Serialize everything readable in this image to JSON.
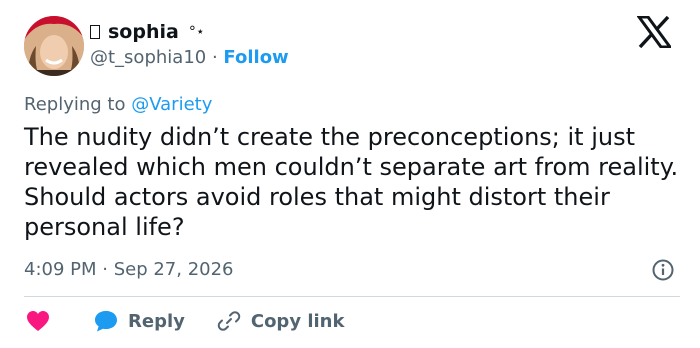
{
  "author": {
    "display_name": "sophia",
    "name_decoration": "°⋆",
    "handle": "@t_sophia10",
    "separator": "·",
    "follow_label": "Follow"
  },
  "reply_context": {
    "prefix": "Replying to",
    "mention": "@Variety"
  },
  "tweet": {
    "text": "The nudity didn’t create the preconceptions; it just revealed which men couldn’t separate art from reality. Should actors avoid roles that might distort their personal life?",
    "time": "4:09 PM · Sep 27, 2026"
  },
  "actions": {
    "reply_label": "Reply",
    "copy_link_label": "Copy link"
  },
  "icons": {
    "logo": "x-logo-icon",
    "info": "info-icon",
    "like": "heart-icon",
    "reply": "speech-bubble-icon",
    "copy": "link-icon"
  },
  "colors": {
    "accent": "#1d9bf0",
    "like": "#f91880",
    "secondary_text": "#536471",
    "primary_text": "#0f1419",
    "divider": "#cfd9de"
  }
}
